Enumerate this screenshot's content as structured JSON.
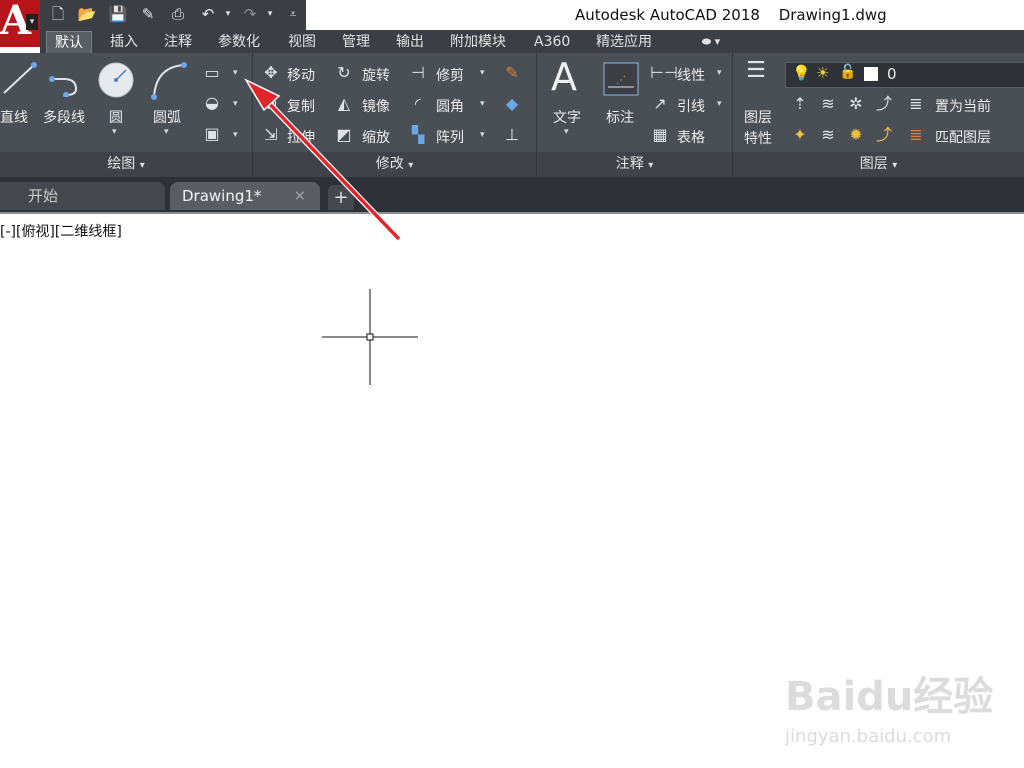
{
  "window": {
    "app_title": "Autodesk AutoCAD 2018",
    "file_name": "Drawing1.dwg"
  },
  "app_button": {
    "letter": "A",
    "icon": "autocad-logo-icon"
  },
  "quick_access": {
    "icons": [
      "new-icon",
      "open-icon",
      "save-icon",
      "save-as-icon",
      "print-icon",
      "undo-icon",
      "redo-icon",
      "customize-icon"
    ]
  },
  "ribbon_tabs": [
    "默认",
    "插入",
    "注释",
    "参数化",
    "视图",
    "管理",
    "输出",
    "附加模块",
    "A360",
    "精选应用"
  ],
  "ribbon_tabs_active": "默认",
  "draw_panel": {
    "title": "绘图",
    "tools": [
      "直线",
      "多段线",
      "圆",
      "圆弧"
    ]
  },
  "modify_panel": {
    "title": "修改",
    "rows": [
      [
        "移动",
        "旋转",
        "修剪"
      ],
      [
        "复制",
        "镜像",
        "圆角"
      ],
      [
        "拉伸",
        "缩放",
        "阵列"
      ]
    ]
  },
  "annotation_panel": {
    "title": "注释",
    "large": [
      "文字",
      "标注"
    ],
    "small": [
      "线性",
      "引线",
      "表格"
    ]
  },
  "layers_panel": {
    "title": "图层",
    "layer_props": [
      "图层",
      "特性"
    ],
    "current_layer": "0",
    "actions": [
      "置为当前",
      "匹配图层"
    ]
  },
  "doc_tabs": {
    "start": "开始",
    "drawing": "Drawing1*",
    "close": "×",
    "add": "+"
  },
  "viewport": {
    "label": "[-][俯视][二维线框]"
  },
  "colors": {
    "accent_red": "#b8151b",
    "ribbon": "#4a4e55",
    "annotation_arrow": "#e0262b"
  },
  "watermark": {
    "brand": "Baidu经验",
    "site": "jingyan.baidu.com"
  }
}
